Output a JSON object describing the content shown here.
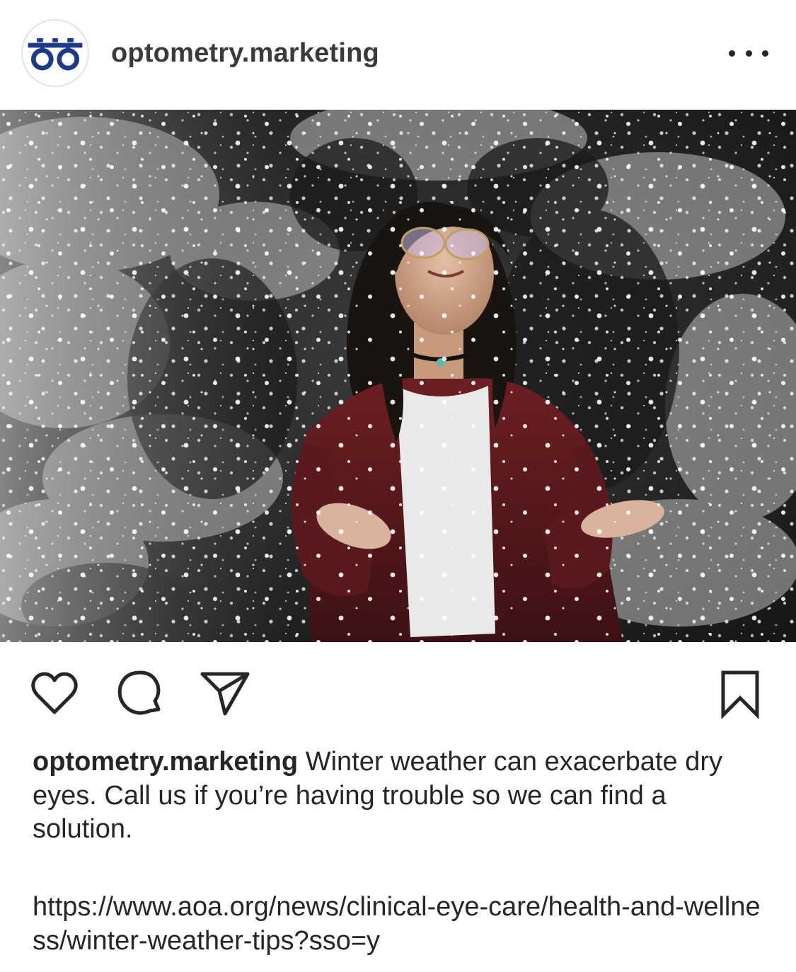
{
  "header": {
    "username": "optometry.marketing",
    "avatar_icon": "glasses-logo-icon",
    "more_icon": "more-options-icon"
  },
  "photo": {
    "subject": "woman-in-snow-photo"
  },
  "actions": {
    "like_icon": "heart-icon",
    "comment_icon": "comment-bubble-icon",
    "share_icon": "paper-plane-icon",
    "save_icon": "bookmark-icon"
  },
  "caption": {
    "username": "optometry.marketing",
    "text": " Winter weather can exacerbate dry eyes. Call us if you’re having trouble so we can find a solution.",
    "link": "https://www.aoa.org/news/clinical-eye-care/health-and-wellness/winter-weather-tips?sso=y"
  },
  "colors": {
    "brand_blue": "#1d3a8a",
    "text": "#262626",
    "background": "#ffffff"
  }
}
